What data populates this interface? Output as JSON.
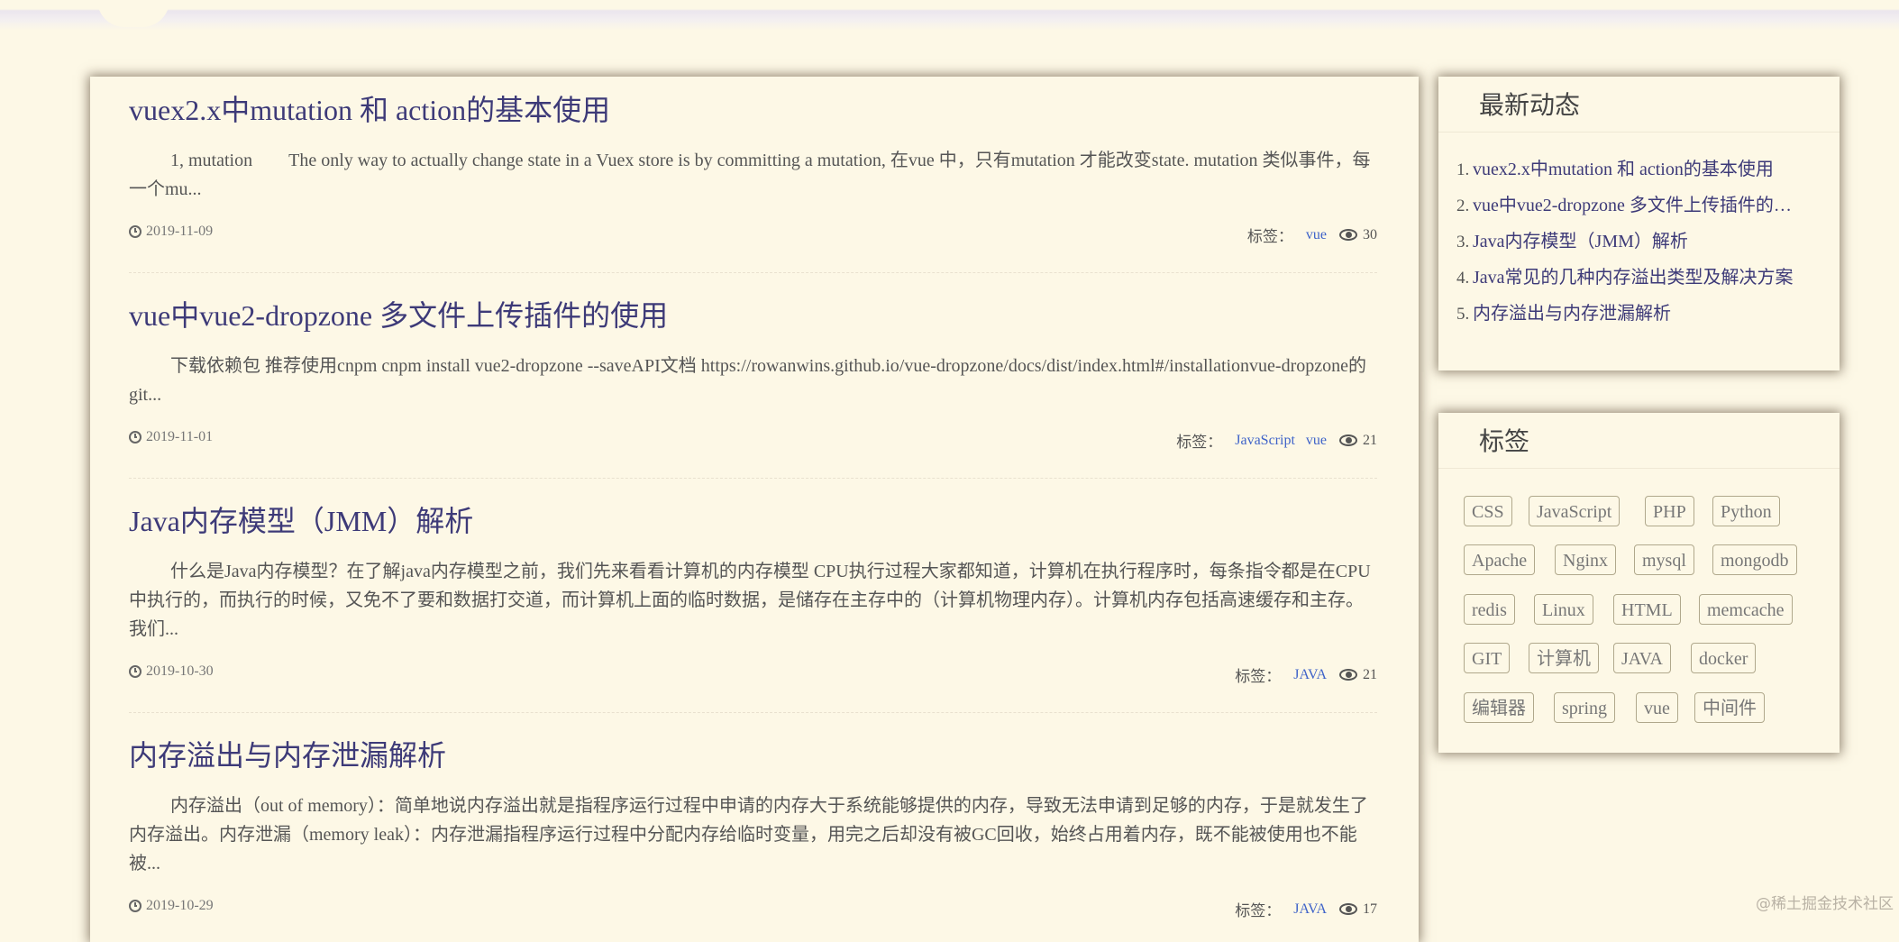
{
  "articles": [
    {
      "title": "vuex2.x中mutation 和 action的基本使用",
      "summary": "1, mutation　　The only way to actually change state in a Vuex store is by committing a mutation, 在vue 中，只有mutation 才能改变state.  mutation 类似事件，每一个mu...",
      "date": "2019-11-09",
      "tags_label": "标签：",
      "tags": [
        "vue"
      ],
      "views": "30"
    },
    {
      "title": "vue中vue2-dropzone 多文件上传插件的使用",
      "summary": "下载依赖包 推荐使用cnpm cnpm install vue2-dropzone --saveAPI文档 https://rowanwins.github.io/vue-dropzone/docs/dist/index.html#/installationvue-dropzone的git...",
      "date": "2019-11-01",
      "tags_label": "标签：",
      "tags": [
        "JavaScript",
        "vue"
      ],
      "views": "21"
    },
    {
      "title": "Java内存模型（JMM）解析",
      "summary": "什么是Java内存模型？在了解java内存模型之前，我们先来看看计算机的内存模型 CPU执行过程大家都知道，计算机在执行程序时，每条指令都是在CPU中执行的，而执行的时候，又免不了要和数据打交道，而计算机上面的临时数据，是储存在主存中的（计算机物理内存）。计算机内存包括高速缓存和主存。我们...",
      "date": "2019-10-30",
      "tags_label": "标签：",
      "tags": [
        "JAVA"
      ],
      "views": "21"
    },
    {
      "title": "内存溢出与内存泄漏解析",
      "summary": "内存溢出（out of memory）：简单地说内存溢出就是指程序运行过程中申请的内存大于系统能够提供的内存，导致无法申请到足够的内存，于是就发生了内存溢出。内存泄漏（memory leak）：内存泄漏指程序运行过程中分配内存给临时变量，用完之后却没有被GC回收，始终占用着内存，既不能被使用也不能被...",
      "date": "2019-10-29",
      "tags_label": "标签：",
      "tags": [
        "JAVA"
      ],
      "views": "17"
    }
  ],
  "sidebar": {
    "news_title": "最新动态",
    "news": [
      {
        "num": "1.",
        "text": "vuex2.x中mutation 和 action的基本使用"
      },
      {
        "num": "2.",
        "text": "vue中vue2-dropzone 多文件上传插件的…"
      },
      {
        "num": "3.",
        "text": "Java内存模型（JMM）解析"
      },
      {
        "num": "4.",
        "text": "Java常见的几种内存溢出类型及解决方案"
      },
      {
        "num": "5.",
        "text": "内存溢出与内存泄漏解析"
      }
    ],
    "tags_title": "标签",
    "tags": [
      "CSS",
      "JavaScript",
      "PHP",
      "Python",
      "Apache",
      "Nginx",
      "mysql",
      "mongodb",
      "redis",
      "Linux",
      "HTML",
      "memcache",
      "GIT",
      "计算机",
      "JAVA",
      "docker",
      "编辑器",
      "spring",
      "vue",
      "中间件"
    ]
  },
  "watermark": "@稀土掘金技术社区",
  "colors": {
    "background": "#fdf8e6",
    "title": "#3d3a78",
    "tag_link": "#3f63c9"
  }
}
